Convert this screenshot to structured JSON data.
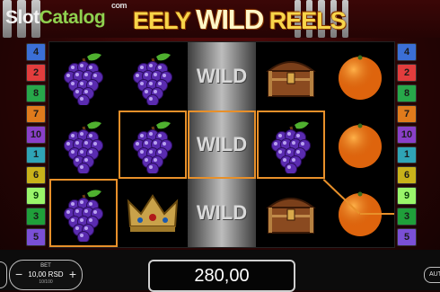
{
  "watermark": {
    "part1": "Slot",
    "part2": "Catalog",
    "suffix": "com"
  },
  "game_title": {
    "part1": "EELY ",
    "wild": "WILD",
    "part2": " REELS"
  },
  "paylines_left": [
    "4",
    "2",
    "8",
    "7",
    "10",
    "1",
    "6",
    "9",
    "3",
    "5"
  ],
  "paylines_right": [
    "4",
    "2",
    "8",
    "7",
    "10",
    "1",
    "6",
    "9",
    "3",
    "5"
  ],
  "payline_colors": [
    "#3b6fd6",
    "#e23d3d",
    "#27a84a",
    "#e07b1c",
    "#8a3fc9",
    "#2fa4b6",
    "#c9b21a",
    "#8cf060",
    "#1f9f3a",
    "#7a4fd6"
  ],
  "reels": [
    [
      "grapes",
      "grapes",
      "grapes"
    ],
    [
      "grapes",
      "grapes",
      "crown"
    ],
    [
      "wild",
      "wild",
      "wild"
    ],
    [
      "chest",
      "grapes",
      "chest"
    ],
    [
      "orange",
      "orange",
      "orange"
    ]
  ],
  "wild_label": "WILD",
  "bet": {
    "label": "BET",
    "value": "10,00 RSD",
    "sub": "10/100",
    "minus": "−",
    "plus": "+"
  },
  "win_amount": "280,00",
  "auto_label": "AUT"
}
